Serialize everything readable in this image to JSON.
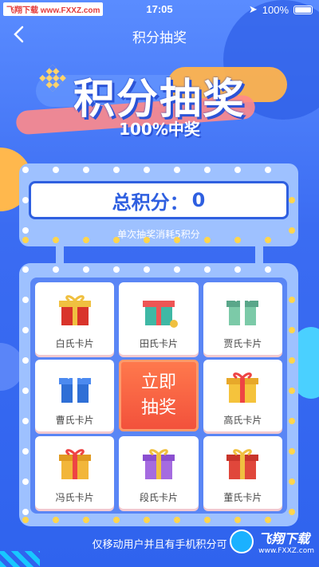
{
  "status_bar": {
    "carrier": "飞翔下载 www.FXXZ.com",
    "time": "17:05",
    "battery": "100%"
  },
  "nav": {
    "back_icon": "chevron-left-icon",
    "title": "积分抽奖"
  },
  "banner": {
    "title": "积分抽奖",
    "subtitle": "100%中奖"
  },
  "score": {
    "label": "总积分：",
    "value": "0",
    "cost_note": "单次抽奖消耗5积分"
  },
  "prizes": [
    {
      "name": "白氏卡片",
      "color": "#d9342b"
    },
    {
      "name": "田氏卡片",
      "color": "#3fb8a5"
    },
    {
      "name": "贾氏卡片",
      "color": "#7ccaa8"
    },
    {
      "name": "曹氏卡片",
      "color": "#2f6fd6"
    },
    {
      "name": "高氏卡片",
      "color": "#f5c33c"
    },
    {
      "name": "冯氏卡片",
      "color": "#f2b63a"
    },
    {
      "name": "段氏卡片",
      "color": "#a56be0"
    },
    {
      "name": "董氏卡片",
      "color": "#e0473b"
    }
  ],
  "draw_button": {
    "line1": "立即",
    "line2": "抽奖"
  },
  "footer": {
    "text": "仅移动用户并且有手机积分可"
  },
  "watermark": {
    "text": "飞翔下载",
    "url": "www.FXXZ.com"
  }
}
